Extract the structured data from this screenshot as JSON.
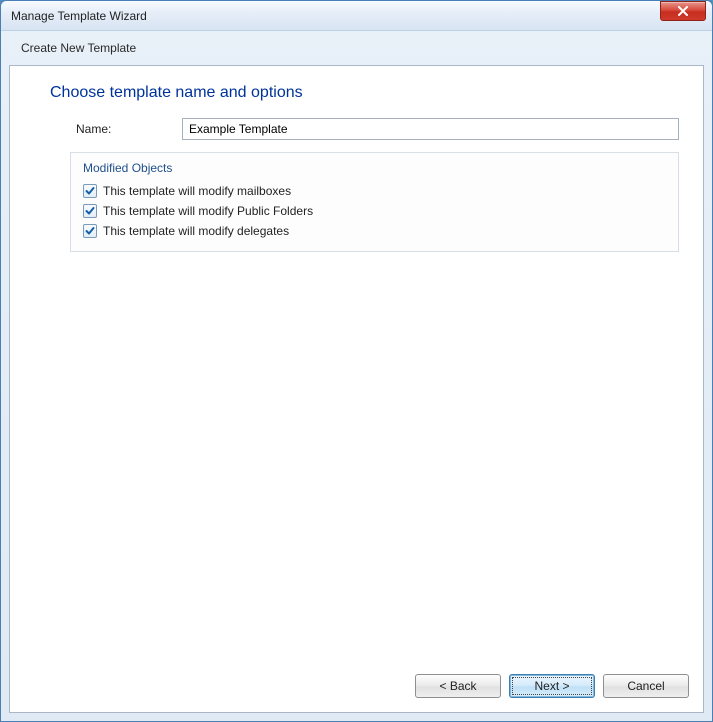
{
  "window": {
    "title": "Manage Template Wizard",
    "subtitle": "Create New Template"
  },
  "page": {
    "heading": "Choose template name and options",
    "name_label": "Name:",
    "name_value": "Example Template"
  },
  "group": {
    "legend": "Modified Objects",
    "items": [
      {
        "label": "This template will modify mailboxes",
        "checked": true
      },
      {
        "label": "This template will modify Public Folders",
        "checked": true
      },
      {
        "label": "This template will modify delegates",
        "checked": true
      }
    ]
  },
  "buttons": {
    "back": "< Back",
    "next": "Next >",
    "cancel": "Cancel"
  }
}
